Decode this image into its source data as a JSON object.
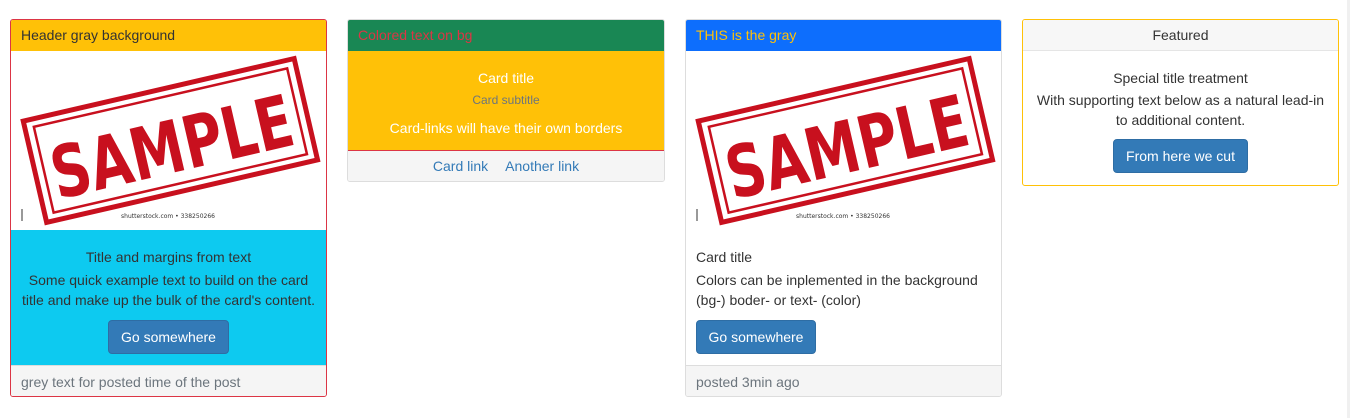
{
  "colors": {
    "warning": "#ffc107",
    "success": "#198754",
    "danger": "#dc3545",
    "primary": "#0d6efd",
    "info": "#0dcaf0",
    "gray": "#f7f7f7",
    "button": "#337ab7",
    "muted": "#6c757d"
  },
  "image": {
    "stamp_text": "SAMPLE",
    "caption": "shutterstock.com • 338250266"
  },
  "card1": {
    "header": "Header gray background",
    "title": "Title and margins from text",
    "text": "Some quick example text to build on the card title and make up the bulk of the card's content.",
    "button": "Go somewhere",
    "footer": "grey text for posted time of the post"
  },
  "card2": {
    "header": "Colored text on bg",
    "title": "Card title",
    "subtitle": "Card subtitle",
    "text": "Card-links will have their own borders",
    "link1": "Card link",
    "link2": "Another link"
  },
  "card3": {
    "header": "THIS is the gray",
    "title": "Card title",
    "text": "Colors can be inplemented in the background (bg-) boder- or text- (color)",
    "button": "Go somewhere",
    "footer": "posted 3min ago"
  },
  "card4": {
    "header": "Featured",
    "title": "Special title treatment",
    "text": "With supporting text below as a natural lead-in to additional content.",
    "button": "From here we cut"
  }
}
